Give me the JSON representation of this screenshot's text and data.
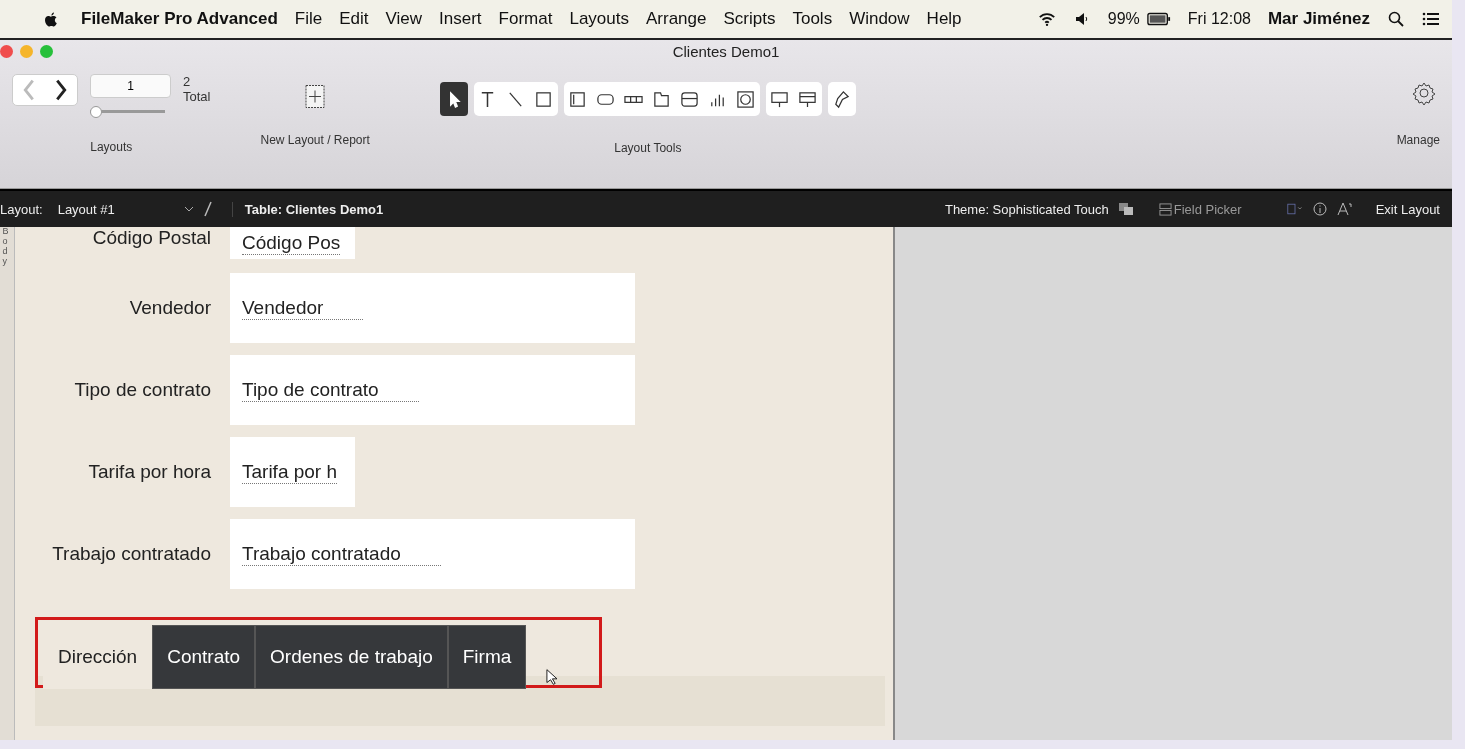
{
  "menubar": {
    "app": "FileMaker Pro Advanced",
    "menus": [
      "File",
      "Edit",
      "View",
      "Insert",
      "Format",
      "Layouts",
      "Arrange",
      "Scripts",
      "Tools",
      "Window",
      "Help"
    ],
    "battery": "99%",
    "clock": "Fri 12:08",
    "user": "Mar Jiménez"
  },
  "window": {
    "title": "Clientes Demo1"
  },
  "toolbar": {
    "layout_number": "2",
    "layout_total": "Total",
    "layout_value": "1",
    "layouts_label": "Layouts",
    "slider": {
      "level": 0
    },
    "new_layout_label": "New Layout / Report",
    "layout_tools_label": "Layout Tools",
    "manage_label": "Manage",
    "tool_groups": [
      {
        "tools": [
          {
            "kind": "pointer",
            "selected": true
          }
        ]
      },
      {
        "tools": [
          {
            "kind": "text",
            "selected": false
          },
          {
            "kind": "line",
            "selected": false
          },
          {
            "kind": "rectangle",
            "selected": false
          }
        ]
      },
      {
        "tools": [
          {
            "kind": "field",
            "selected": false
          },
          {
            "kind": "button",
            "selected": false
          },
          {
            "kind": "button-bar",
            "selected": false
          },
          {
            "kind": "tab-control",
            "selected": false
          },
          {
            "kind": "slide-control",
            "selected": false
          },
          {
            "kind": "chart",
            "selected": false
          },
          {
            "kind": "web-viewer",
            "selected": false
          }
        ]
      },
      {
        "tools": [
          {
            "kind": "popover",
            "selected": false
          },
          {
            "kind": "portal",
            "selected": false
          }
        ]
      },
      {
        "tools": [
          {
            "kind": "format-painter",
            "selected": false
          }
        ]
      }
    ]
  },
  "layout_bar": {
    "layout_label": "Layout:",
    "layout_name": "Layout #1",
    "table": "Table: Clientes Demo1",
    "theme": "Theme: Sophisticated Touch",
    "field_picker": "Field Picker",
    "exit": "Exit Layout"
  },
  "part_label": "Body",
  "fields": [
    {
      "label": "Código Postal",
      "value": "Código Pos",
      "kind": "short"
    },
    {
      "label": "Vendedor",
      "value": "Vendedor",
      "kind": "long"
    },
    {
      "label": "Tipo de contrato",
      "value": "Tipo de contrato",
      "kind": "long"
    },
    {
      "label": "Tarifa por hora",
      "value": "Tarifa por h",
      "kind": "short"
    },
    {
      "label": "Trabajo contratado",
      "value": "Trabajo contratado",
      "kind": "long"
    }
  ],
  "tabs": [
    {
      "label": "Dirección",
      "selected": true
    },
    {
      "label": "Contrato",
      "selected": false
    },
    {
      "label": "Ordenes de trabajo",
      "selected": false
    },
    {
      "label": "Firma",
      "selected": false
    }
  ]
}
